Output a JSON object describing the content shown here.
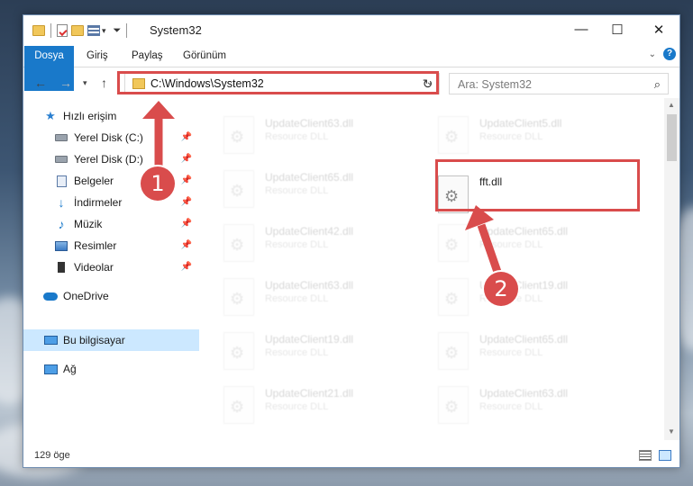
{
  "window": {
    "title": "System32",
    "controls": {
      "minimize": "—",
      "maximize": "☐",
      "close": "✕"
    }
  },
  "ribbon": {
    "tabs": [
      "Dosya",
      "Giriş",
      "Paylaş",
      "Görünüm"
    ]
  },
  "nav": {
    "path": "C:\\Windows\\System32",
    "search_placeholder": "Ara: System32"
  },
  "sidebar": {
    "items": [
      {
        "label": "Hızlı erişim",
        "icon": "star-icon",
        "pinned": false
      },
      {
        "label": "Yerel Disk (C:)",
        "icon": "disk-icon",
        "pinned": true
      },
      {
        "label": "Yerel Disk (D:)",
        "icon": "disk-icon",
        "pinned": true
      },
      {
        "label": "Belgeler",
        "icon": "documents-icon",
        "pinned": true
      },
      {
        "label": "İndirmeler",
        "icon": "downloads-icon",
        "pinned": true
      },
      {
        "label": "Müzik",
        "icon": "music-icon",
        "pinned": true
      },
      {
        "label": "Resimler",
        "icon": "pictures-icon",
        "pinned": true
      },
      {
        "label": "Videolar",
        "icon": "videos-icon",
        "pinned": true
      },
      {
        "label": "OneDrive",
        "icon": "onedrive-icon",
        "pinned": false
      },
      {
        "label": "Bu bilgisayar",
        "icon": "computer-icon",
        "pinned": false,
        "selected": true
      },
      {
        "label": "Ağ",
        "icon": "network-icon",
        "pinned": false
      }
    ]
  },
  "files": {
    "left": [
      {
        "name": "UpdateClient63.dll",
        "desc": "Resource DLL"
      },
      {
        "name": "UpdateClient65.dll",
        "desc": "Resource DLL"
      },
      {
        "name": "UpdateClient42.dll",
        "desc": "Resource DLL"
      },
      {
        "name": "UpdateClient63.dll",
        "desc": "Resource DLL"
      },
      {
        "name": "UpdateClient19.dll",
        "desc": "Resource DLL"
      },
      {
        "name": "UpdateClient21.dll",
        "desc": "Resource DLL"
      }
    ],
    "right": [
      {
        "name": "UpdateClient5.dll",
        "desc": "Resource DLL"
      },
      {
        "name": "fft.dll",
        "desc": "",
        "highlighted": true
      },
      {
        "name": "UpdateClient65.dll",
        "desc": "Resource DLL"
      },
      {
        "name": "UpdateClient19.dll",
        "desc": "Resource DLL"
      },
      {
        "name": "UpdateClient65.dll",
        "desc": "Resource DLL"
      },
      {
        "name": "UpdateClient63.dll",
        "desc": "Resource DLL"
      }
    ]
  },
  "status": {
    "count": "129 öge"
  },
  "annotations": {
    "step1": "1",
    "step2": "2",
    "color": "#d94c4c"
  }
}
